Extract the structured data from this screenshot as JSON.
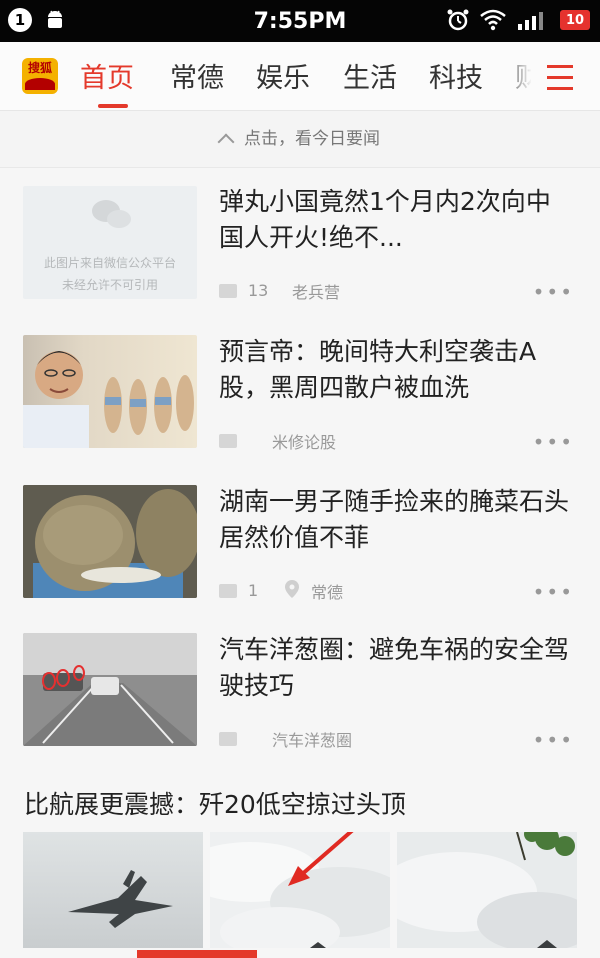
{
  "status_bar": {
    "notification_count": "1",
    "time": "7:55PM",
    "battery": "10"
  },
  "nav": {
    "logo_text": "搜狐",
    "tabs": [
      "首页",
      "常德",
      "娱乐",
      "生活",
      "科技",
      "财"
    ],
    "active_tab": "首页",
    "accent_color": "#e4392b"
  },
  "hint": {
    "text": "点击，看今日要闻"
  },
  "news": [
    {
      "title": "弹丸小国竟然1个月内2次向中国人开火!绝不...",
      "comments": "13",
      "source": "老兵营",
      "thumb_caption_1": "此图片来自微信公众平台",
      "thumb_caption_2": "未经允许不可引用"
    },
    {
      "title": "预言帝：晚间特大利空袭击A股，黑周四散户被血洗",
      "comments": "",
      "source": "米修论股"
    },
    {
      "title": "湖南一男子随手捡来的腌菜石头 居然价值不菲",
      "comments": "1",
      "location": "常德"
    },
    {
      "title": "汽车洋葱圈：避免车祸的安全驾驶技巧",
      "comments": "",
      "source": "汽车洋葱圈"
    }
  ],
  "gallery": {
    "title": "比航展更震撼：歼20低空掠过头顶"
  }
}
